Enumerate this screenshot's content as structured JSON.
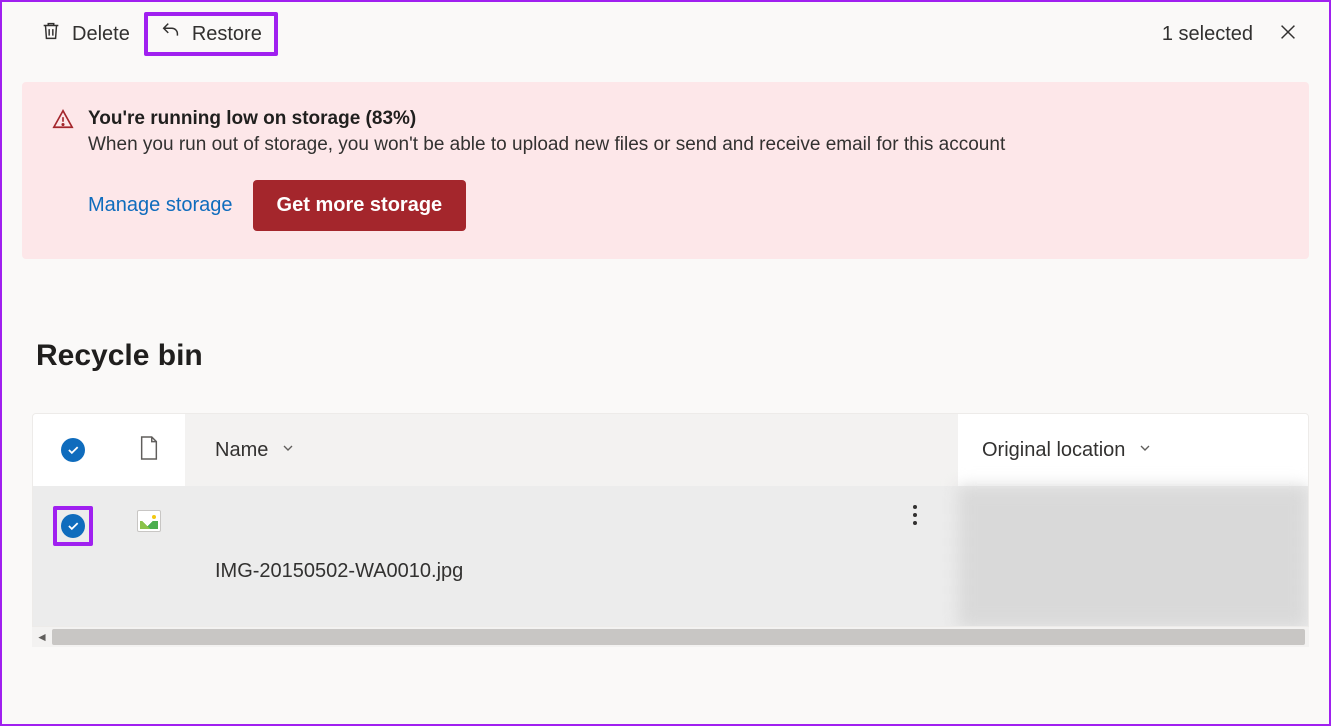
{
  "toolbar": {
    "delete_label": "Delete",
    "restore_label": "Restore",
    "selected_text": "1 selected"
  },
  "alert": {
    "title": "You're running low on storage (83%)",
    "body": "When you run out of storage, you won't be able to upload new files or send and receive email for this account",
    "manage_label": "Manage storage",
    "getmore_label": "Get more storage"
  },
  "page": {
    "title": "Recycle bin"
  },
  "table": {
    "col_name": "Name",
    "col_location": "Original location",
    "rows": [
      {
        "filename": "IMG-20150502-WA0010.jpg",
        "original_location": ""
      }
    ]
  }
}
